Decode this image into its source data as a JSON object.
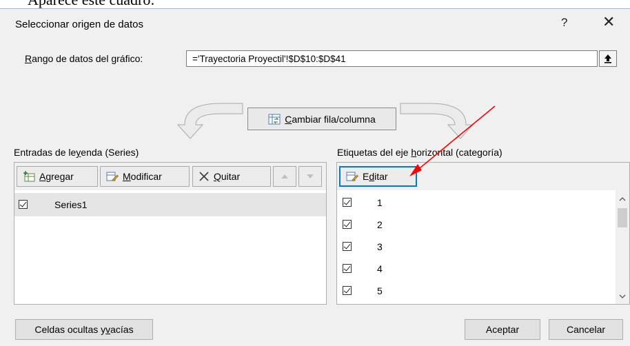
{
  "document_text": "Aparece este cuadro:",
  "dialog": {
    "title": "Seleccionar origen de datos",
    "help_label": "?",
    "close_label": "✕"
  },
  "range": {
    "label_underlined": "R",
    "label_rest": "ango de datos del gráfico:",
    "value": "='Trayectoria Proyectil'!$D$10:$D$41"
  },
  "switch_button": {
    "label_underlined": "C",
    "label_rest": "ambiar fila/columna"
  },
  "legend": {
    "label_pre": "Entradas de le",
    "label_underlined": "y",
    "label_post": "enda (Series)",
    "add_u": "A",
    "add_rest": "gregar",
    "edit_u": "M",
    "edit_rest": "odificar",
    "remove_u": "Q",
    "remove_rest": "uitar",
    "series": [
      "Series1"
    ]
  },
  "axis": {
    "label_pre": "Etiquetas del eje ",
    "label_underlined": "h",
    "label_post": "orizontal (categoría)",
    "edit_pre": "E",
    "edit_u": "d",
    "edit_post": "itar",
    "categories": [
      "1",
      "2",
      "3",
      "4",
      "5"
    ]
  },
  "footer": {
    "hidden_pre": "Celdas ocultas y ",
    "hidden_u": "v",
    "hidden_post": "acías",
    "ok": "Aceptar",
    "cancel": "Cancelar"
  },
  "colors": {
    "accent": "#0078d7",
    "annotation_arrow": "#ff0000"
  }
}
